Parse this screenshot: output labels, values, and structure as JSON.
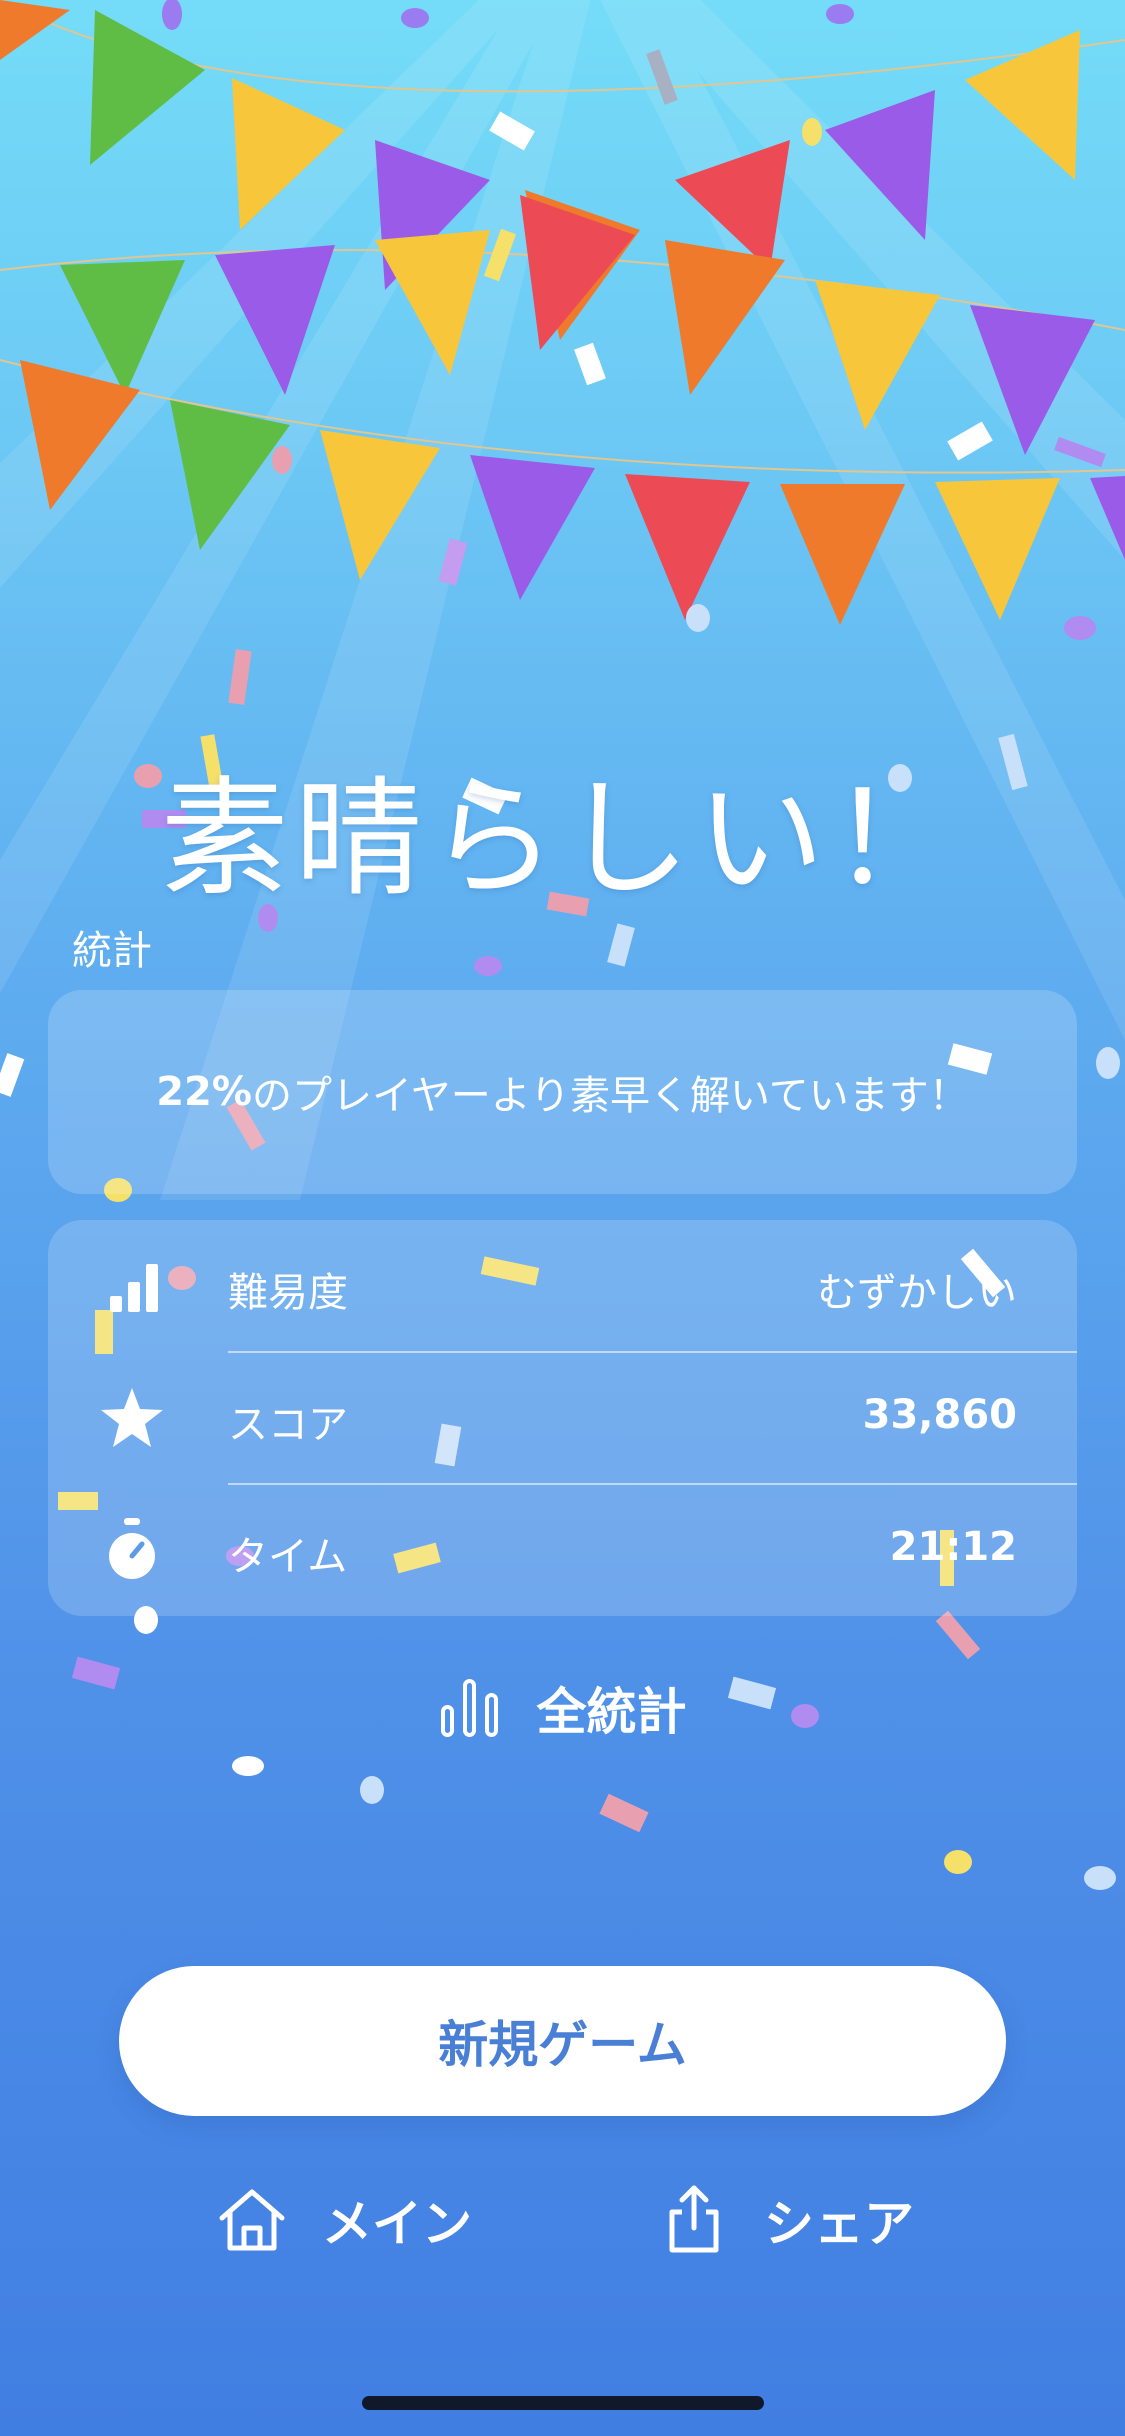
{
  "title": "素晴らしい！",
  "stats_section": {
    "label": "統計",
    "percentile_value": "22%",
    "percentile_text": "のプレイヤーより素早く解いています！"
  },
  "stats": [
    {
      "icon": "signal-bars-icon",
      "label": "難易度",
      "value": "むずかしい"
    },
    {
      "icon": "star-icon",
      "label": "スコア",
      "value": "33,860"
    },
    {
      "icon": "stopwatch-icon",
      "label": "タイム",
      "value": "21:12"
    }
  ],
  "all_stats_button": {
    "icon": "bar-chart-icon",
    "label": "全統計"
  },
  "new_game_button": {
    "label": "新規ゲーム"
  },
  "bottom_actions": {
    "home": {
      "icon": "home-icon",
      "label": "メイン"
    },
    "share": {
      "icon": "share-icon",
      "label": "シェア"
    }
  },
  "colors": {
    "background_top": "#74dcf8",
    "background_bottom": "#417ee2",
    "accent_text": "#4a7fd6",
    "pennant_palette": [
      "#f07a2c",
      "#5fbd45",
      "#f8c63a",
      "#9a5be8",
      "#ec4b55"
    ]
  }
}
